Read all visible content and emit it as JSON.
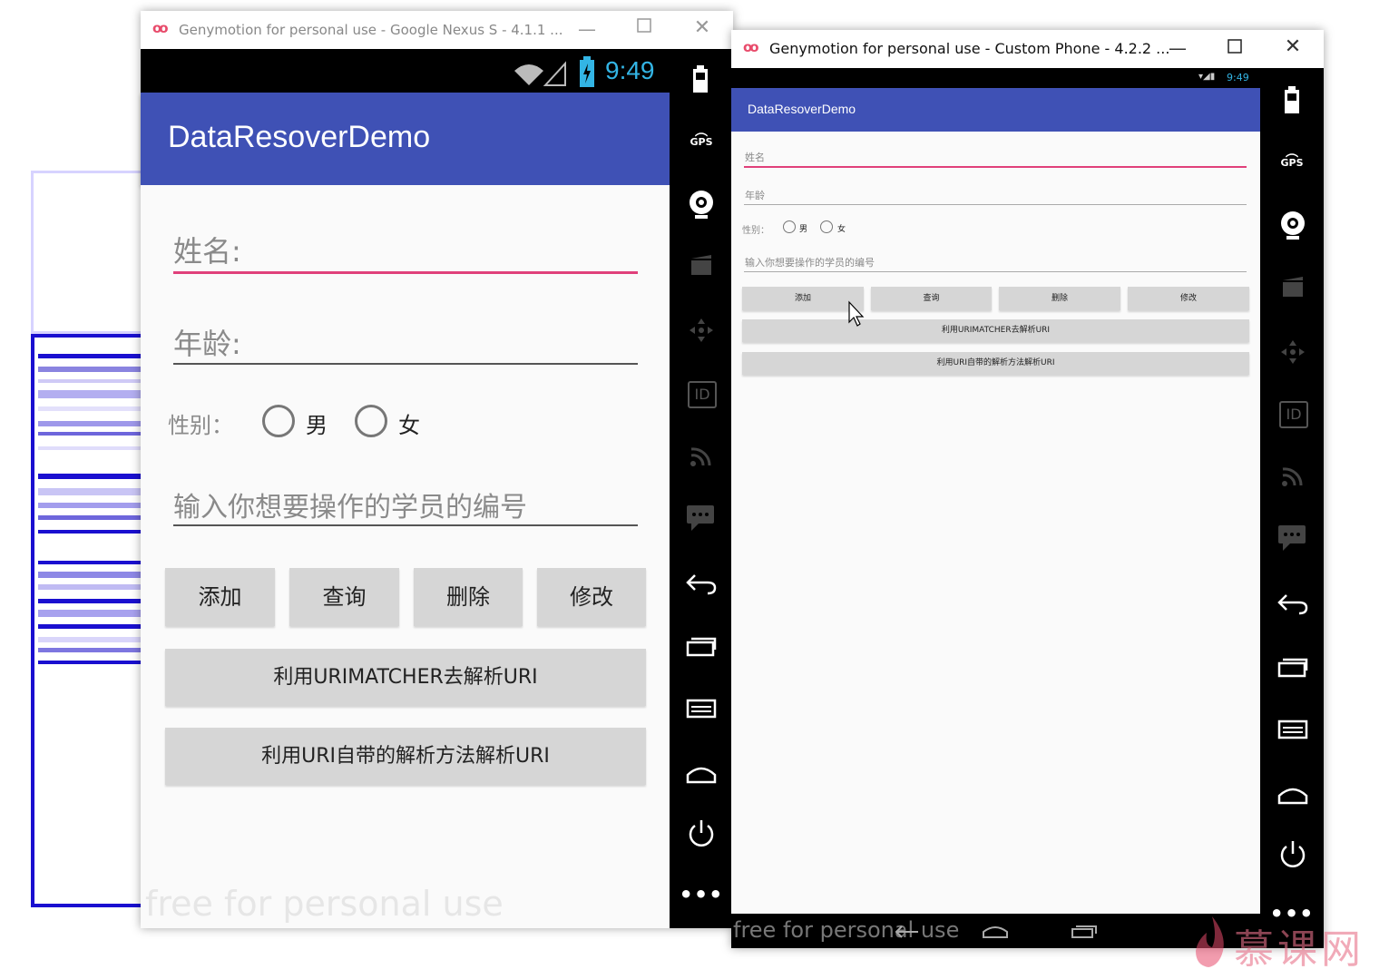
{
  "window1": {
    "title": "Genymotion for personal use - Google Nexus S - 4.1.1 ...",
    "status_time": "9:49",
    "app_title": "DataResoverDemo",
    "name_hint": "姓名:",
    "age_hint": "年龄:",
    "gender_label": "性别：",
    "radio_male": "男",
    "radio_female": "女",
    "id_hint": "输入你想要操作的学员的编号",
    "btn_add": "添加",
    "btn_query": "查询",
    "btn_delete": "删除",
    "btn_update": "修改",
    "btn_urimatcher": "利用URIMATCHER去解析URI",
    "btn_uri_parse": "利用URI自带的解析方法解析URI",
    "watermark": "free for personal use"
  },
  "window2": {
    "title": "Genymotion for personal use - Custom Phone - 4.2.2 ...",
    "status_time": "9:49",
    "app_title": "DataResoverDemo",
    "name_hint": "姓名",
    "age_hint": "年龄",
    "gender_label": "性别：",
    "radio_male": "男",
    "radio_female": "女",
    "id_hint": "输入你想要操作的学员的编号",
    "btn_add": "添加",
    "btn_query": "查询",
    "btn_delete": "删除",
    "btn_update": "修改",
    "btn_urimatcher": "利用URIMATCHER去解析URI",
    "btn_uri_parse": "利用URI自带的解析方法解析URI",
    "watermark": "free for personal use"
  },
  "sidebar_icons": [
    "battery-icon",
    "gps-icon",
    "webcam-icon",
    "video-icon",
    "dpad-icon",
    "id-icon",
    "rss-icon",
    "sms-icon",
    "back-icon",
    "recent-apps-icon",
    "menu-icon",
    "home-icon",
    "power-icon",
    "more-icon"
  ],
  "gps_label": "GPS",
  "id_label": "ID",
  "brand_logo": "慕课网",
  "colors": {
    "app_bar": "#3f51b5",
    "accent": "#e0407a",
    "logo_pink": "#e84b6b",
    "bg_stripes": "#1a0fd0"
  }
}
